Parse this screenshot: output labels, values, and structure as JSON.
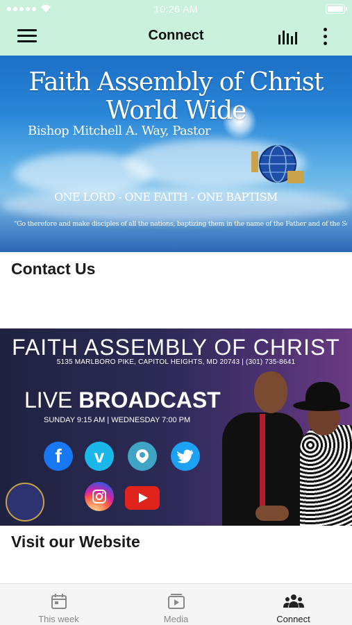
{
  "status_bar": {
    "time": "10:26 AM",
    "signal_icon": "signal-dots-icon",
    "wifi_icon": "wifi-icon",
    "battery_icon": "battery-icon"
  },
  "app_bar": {
    "title": "Connect",
    "background": "#c9f1dc",
    "menu_icon": "hamburger-menu-icon",
    "chart_icon": "equalizer-bars-icon",
    "more_icon": "more-vertical-icon"
  },
  "banner1": {
    "title": "Faith Assembly of Christ World Wide",
    "pastor": "Bishop Mitchell A. Way, Pastor",
    "motto": "ONE LORD - ONE FAITH - ONE BAPTISM",
    "verse": "\"Go therefore and make disciples of all the nations, baptizing them in the name of the Father and of the Son and of the Holy"
  },
  "sections": {
    "contact": "Contact Us",
    "website": "Visit our Website"
  },
  "banner2": {
    "title": "FAITH ASSEMBLY OF CHRIST",
    "address": "5135 MARLBORO PIKE, CAPITOL HEIGHTS, MD 20743 | (301) 735-8641",
    "live_prefix": "LIVE",
    "live_word": "BROADCAST",
    "times": "SUNDAY 9:15 AM | WEDNESDAY 7:00 PM",
    "social_icons": [
      "facebook-icon",
      "vimeo-icon",
      "periscope-icon",
      "twitter-icon",
      "instagram-icon",
      "youtube-icon"
    ]
  },
  "bottom_nav": {
    "items": [
      {
        "label": "This week",
        "icon": "calendar-icon",
        "active": false
      },
      {
        "label": "Media",
        "icon": "media-play-icon",
        "active": false
      },
      {
        "label": "Connect",
        "icon": "people-group-icon",
        "active": true
      }
    ]
  }
}
